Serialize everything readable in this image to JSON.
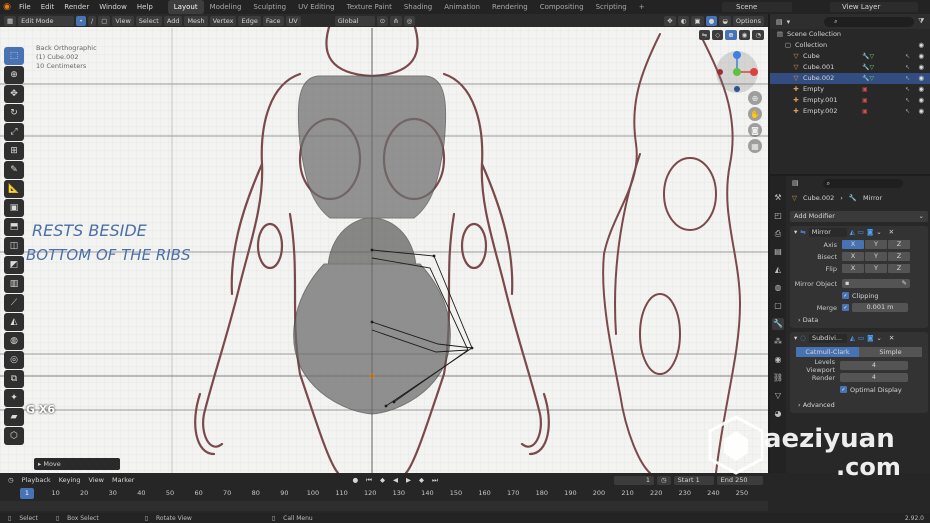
{
  "menu": {
    "items": [
      "File",
      "Edit",
      "Render",
      "Window",
      "Help"
    ],
    "workspaces": [
      "Layout",
      "Modeling",
      "Sculpting",
      "UV Editing",
      "Texture Paint",
      "Shading",
      "Animation",
      "Rendering",
      "Compositing",
      "Scripting"
    ],
    "active_workspace": "Layout",
    "scene": "Scene",
    "view_layer": "View Layer"
  },
  "viewport": {
    "mode": "Edit Mode",
    "menus": [
      "View",
      "Select",
      "Add",
      "Mesh",
      "Vertex",
      "Edge",
      "Face",
      "UV"
    ],
    "transform_orientation": "Global",
    "options_label": "Options",
    "overlay_lines": [
      "Back Orthographic",
      "(1) Cube.002",
      "10 Centimeters"
    ],
    "annotation_line1": "RESTS BESIDE",
    "annotation_line2": "BOTTOM OF THE RIBS",
    "grab_text": "G  X6",
    "last_op": "Move"
  },
  "outliner": {
    "root": "Scene Collection",
    "items": [
      {
        "label": "Collection",
        "type": "collection"
      },
      {
        "label": "Cube",
        "type": "mesh"
      },
      {
        "label": "Cube.001",
        "type": "mesh"
      },
      {
        "label": "Cube.002",
        "type": "mesh",
        "selected": true
      },
      {
        "label": "Empty",
        "type": "empty"
      },
      {
        "label": "Empty.001",
        "type": "empty"
      },
      {
        "label": "Empty.002",
        "type": "empty"
      }
    ]
  },
  "properties": {
    "object_name": "Cube.002",
    "modifier_context": "Mirror",
    "add_modifier": "Add Modifier",
    "mirror": {
      "name": "Mirror",
      "axis_label": "Axis",
      "bisect_label": "Bisect",
      "flip_label": "Flip",
      "axes": [
        "X",
        "Y",
        "Z"
      ],
      "mirror_object_label": "Mirror Object",
      "clipping_label": "Clipping",
      "merge_label": "Merge",
      "merge_value": "0.001 m",
      "data_label": "Data"
    },
    "subdiv": {
      "name": "Subdivi...",
      "catmull": "Catmull-Clark",
      "simple": "Simple",
      "levels_viewport_label": "Levels Viewport",
      "levels_viewport": "4",
      "render_label": "Render",
      "render": "4",
      "optimal_display": "Optimal Display",
      "advanced": "Advanced"
    }
  },
  "timeline": {
    "menus": [
      "Playback",
      "Keying",
      "View",
      "Marker"
    ],
    "current_frame": "1",
    "start_label": "Start",
    "start": "1",
    "end_label": "End",
    "end": "250",
    "ticks": [
      "1",
      "10",
      "20",
      "30",
      "40",
      "50",
      "60",
      "70",
      "80",
      "90",
      "100",
      "110",
      "120",
      "130",
      "140",
      "150",
      "160",
      "170",
      "180",
      "190",
      "200",
      "210",
      "220",
      "230",
      "240",
      "250"
    ]
  },
  "statusbar": {
    "select": "Select",
    "box_select": "Box Select",
    "rotate": "Rotate View",
    "call_menu": "Call Menu",
    "version": "2.92.0"
  },
  "watermark": {
    "line1": "aeziyuan",
    "line2": ".com"
  },
  "colors": {
    "accent": "#4772b3",
    "orange": "#e87d0d",
    "panel": "#282828"
  }
}
